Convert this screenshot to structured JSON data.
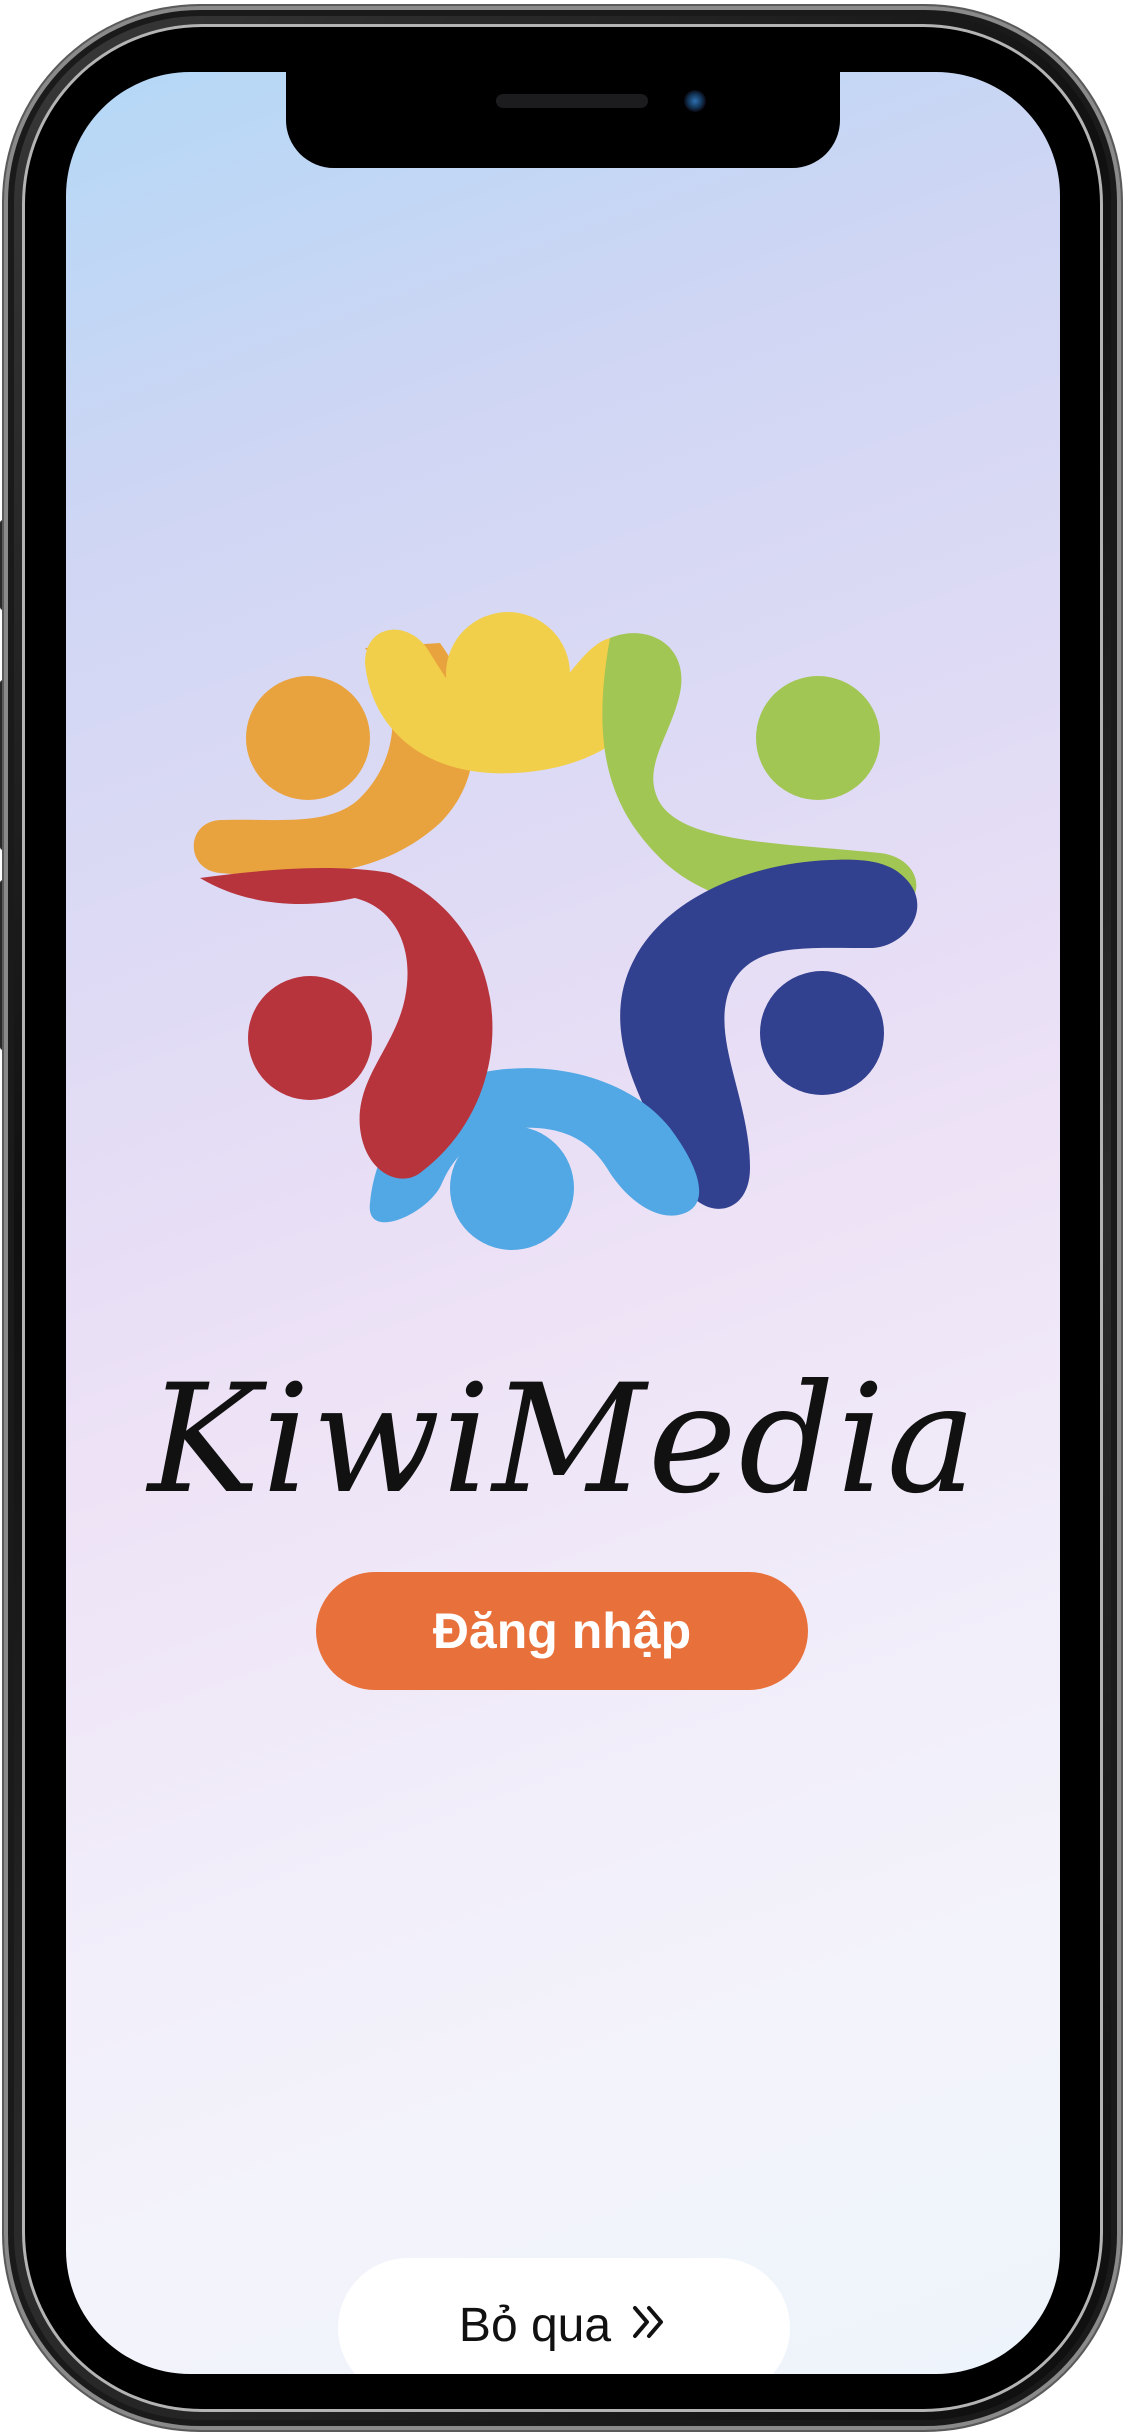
{
  "app": {
    "brand_name": "KiwiMedia",
    "logo_icon": "community-circle-logo",
    "logo_colors": {
      "yellow": "#f2cf4a",
      "green": "#a2c653",
      "navy": "#31408f",
      "blue": "#51a8e4",
      "red": "#b8343c",
      "orange": "#e9a33e"
    }
  },
  "actions": {
    "login_label": "Đăng nhập",
    "login_color": "#e8703a",
    "skip_label": "Bỏ qua",
    "skip_icon": "double-chevron-right-icon"
  }
}
